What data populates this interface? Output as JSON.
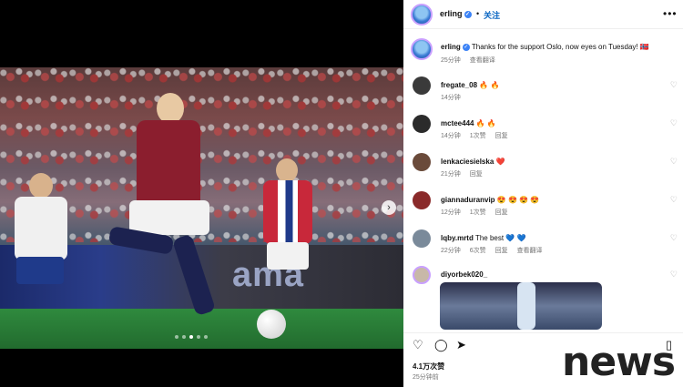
{
  "header": {
    "username": "erling",
    "follow_label": "关注",
    "separator": "•",
    "more_label": "•••"
  },
  "caption": {
    "username": "erling",
    "text": "Thanks for the support Oslo, now eyes on Tuesday! 🇳🇴",
    "time": "25分钟",
    "translate": "查看翻译"
  },
  "comments": [
    {
      "user": "fregate_08",
      "text": "🔥 🔥",
      "time": "14分钟",
      "likes": "",
      "reply": ""
    },
    {
      "user": "mctee444",
      "text": "🔥 🔥",
      "time": "14分钟",
      "likes": "1次赞",
      "reply": "回复"
    },
    {
      "user": "lenkaciesielska",
      "text": "❤️",
      "time": "21分钟",
      "likes": "",
      "reply": "回复"
    },
    {
      "user": "giannaduranvip",
      "text": "😍 😍 😍 😍",
      "time": "12分钟",
      "likes": "1次赞",
      "reply": "回复"
    },
    {
      "user": "lqby.mrtd",
      "text": "The best 💙 💙",
      "time": "22分钟",
      "likes": "6次赞",
      "reply": "回复",
      "translate": "查看翻译"
    },
    {
      "user": "diyorbek020_",
      "text": "",
      "time": "",
      "likes": "",
      "reply": ""
    }
  ],
  "actions": {
    "likes_count": "4.1万次赞",
    "time_ago": "25分钟前"
  },
  "photo": {
    "board_text": "ama",
    "carousel_next": "›"
  },
  "watermark": "news",
  "colors": {
    "accent": "#0a66c2",
    "jersey_red": "#8b1e2e",
    "pitch_green": "#2f8a3e"
  }
}
